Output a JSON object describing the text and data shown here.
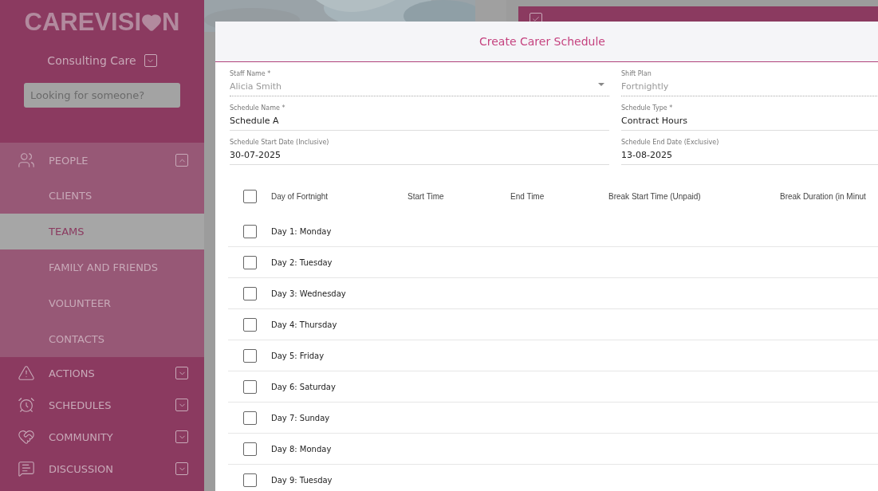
{
  "sidebar": {
    "logo": {
      "start": "CAREVISI",
      "end": "N"
    },
    "organisation": "Consulting Care",
    "search": {
      "placeholder": "Looking for someone?"
    },
    "nav": [
      {
        "label": "PEOPLE",
        "kind": "people",
        "expanded": true,
        "children": [
          {
            "label": "CLIENTS",
            "selected": false
          },
          {
            "label": "TEAMS",
            "selected": true
          },
          {
            "label": "FAMILY AND FRIENDS",
            "selected": false
          },
          {
            "label": "VOLUNTEER",
            "selected": false
          },
          {
            "label": "CONTACTS",
            "selected": false
          }
        ]
      },
      {
        "label": "ACTIONS",
        "kind": "warning",
        "expanded": false
      },
      {
        "label": "SCHEDULES",
        "kind": "clock",
        "expanded": false
      },
      {
        "label": "COMMUNITY",
        "kind": "heart",
        "expanded": false
      },
      {
        "label": "DISCUSSION",
        "kind": "chat",
        "expanded": false
      }
    ]
  },
  "dialog": {
    "title": "Create Carer Schedule",
    "fields": [
      {
        "label": "Staff Name *",
        "value": "Alicia Smith",
        "kind": "select",
        "disabled": true
      },
      {
        "label": "Shift Plan",
        "value": "Fortnightly",
        "kind": "text",
        "disabled": true
      },
      {
        "label": "Schedule Name *",
        "value": "Schedule A",
        "kind": "text",
        "disabled": false
      },
      {
        "label": "Schedule Type *",
        "value": "Contract Hours",
        "kind": "text",
        "disabled": false
      },
      {
        "label": "Schedule Start Date (Inclusive)",
        "value": "30-07-2025",
        "kind": "text",
        "disabled": false
      },
      {
        "label": "Schedule End Date (Exclusive)",
        "value": "13-08-2025",
        "kind": "text",
        "disabled": false
      }
    ],
    "table": {
      "select_all": {
        "checked": false
      },
      "columns": [
        "Day of Fortnight",
        "Start Time",
        "End Time",
        "Break Start Time (Unpaid)",
        "Break Duration (in Minut"
      ],
      "rows": [
        {
          "day": "Day 1: Monday",
          "checked": false
        },
        {
          "day": "Day 2: Tuesday",
          "checked": false
        },
        {
          "day": "Day 3: Wednesday",
          "checked": false
        },
        {
          "day": "Day 4: Thursday",
          "checked": false
        },
        {
          "day": "Day 5: Friday",
          "checked": false
        },
        {
          "day": "Day 6: Saturday",
          "checked": false
        },
        {
          "day": "Day 7: Sunday",
          "checked": false
        },
        {
          "day": "Day 8: Monday",
          "checked": false
        },
        {
          "day": "Day 9: Tuesday",
          "checked": false
        }
      ]
    }
  }
}
